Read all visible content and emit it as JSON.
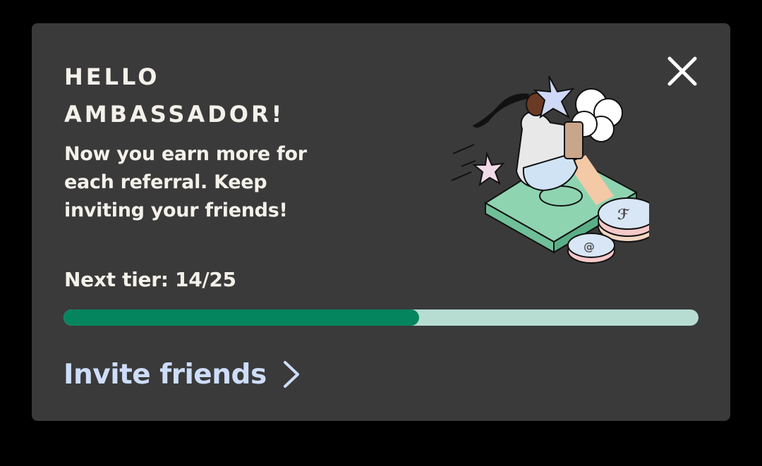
{
  "card": {
    "title": "HELLO AMBASSADOR!",
    "description": "Now you earn more for each referral. Keep inviting your friends!",
    "close_icon": "close-icon"
  },
  "tier": {
    "label": "Next tier: 14/25",
    "current": 14,
    "target": 25
  },
  "invite": {
    "label": "Invite friends",
    "icon": "chevron-right-icon"
  },
  "illustration": {
    "icon": "ambassador-illustration"
  },
  "colors": {
    "background": "#000000",
    "card": "#3a3a3a",
    "text": "#f4f1ea",
    "progress_fill": "#05855e",
    "progress_track": "#b7ddd3",
    "link": "#cdddfa"
  }
}
